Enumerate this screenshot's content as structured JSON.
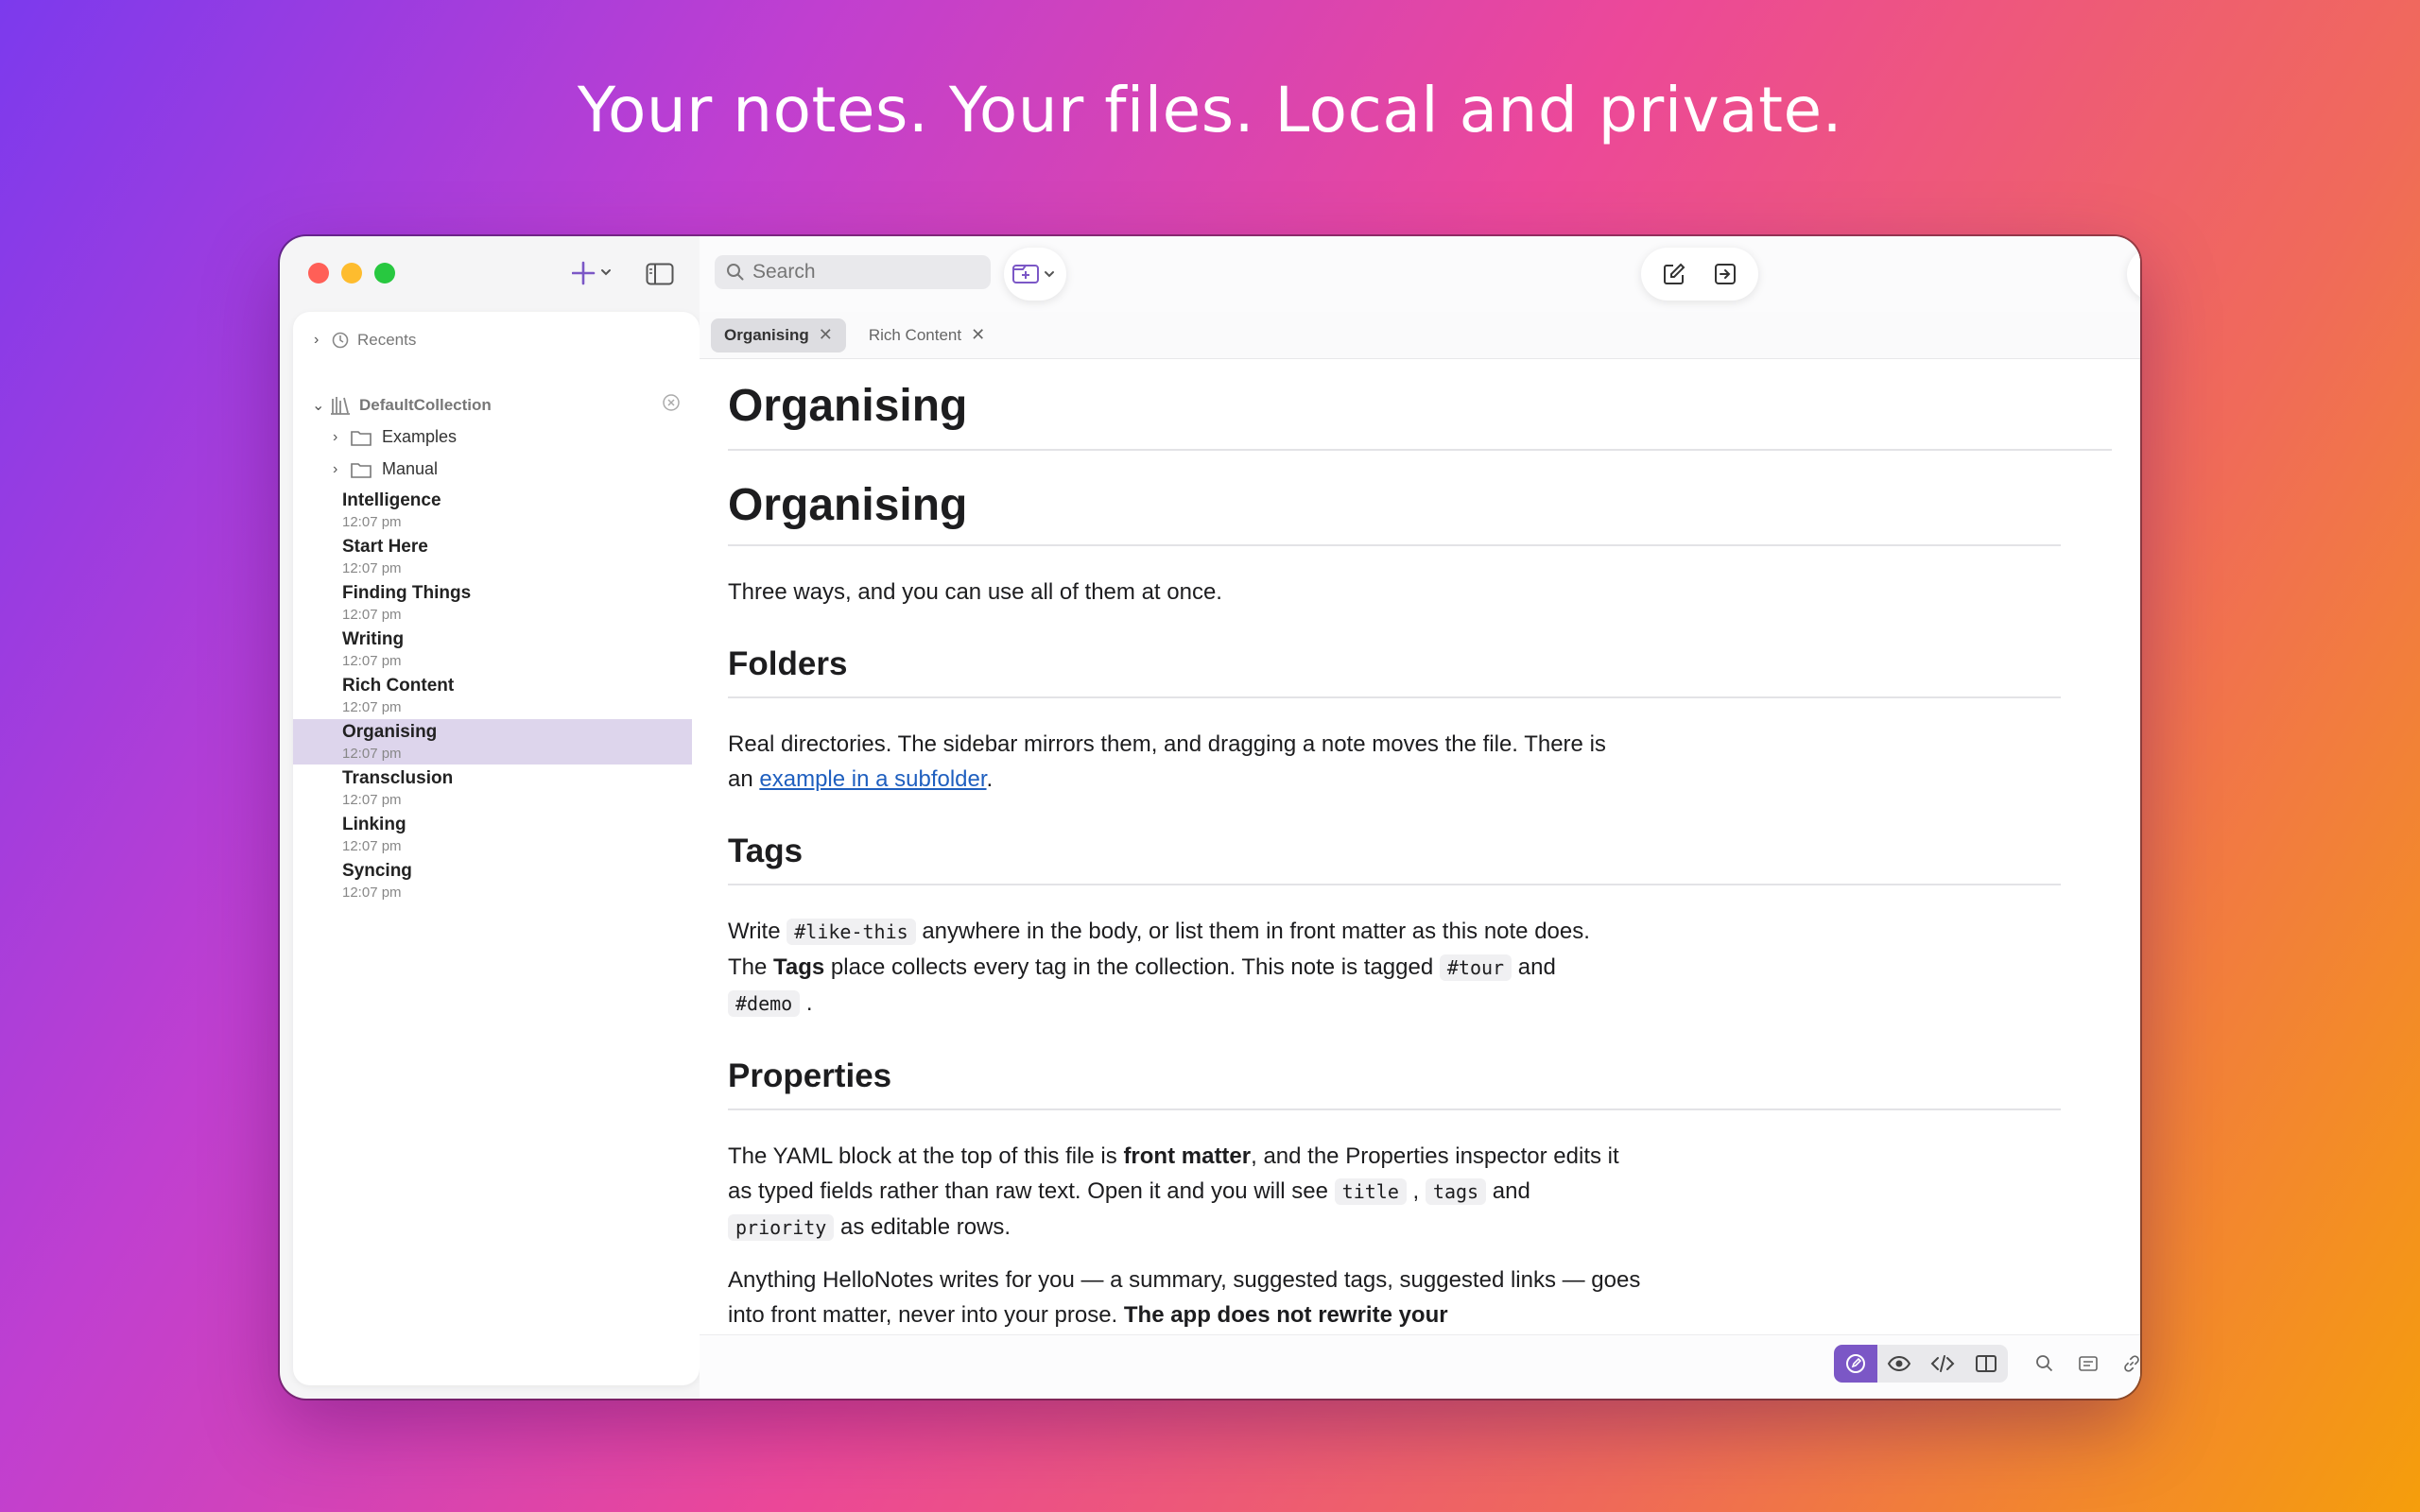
{
  "headline": "Your notes. Your files. Local and private.",
  "toolbar": {
    "search_placeholder": "Search"
  },
  "sidebar": {
    "recents_label": "Recents",
    "collection_label": "DefaultCollection",
    "folders": [
      {
        "label": "Examples"
      },
      {
        "label": "Manual"
      }
    ],
    "notes": [
      {
        "title": "Intelligence",
        "time": "12:07 pm"
      },
      {
        "title": "Start Here",
        "time": "12:07 pm"
      },
      {
        "title": "Finding Things",
        "time": "12:07 pm"
      },
      {
        "title": "Writing",
        "time": "12:07 pm"
      },
      {
        "title": "Rich Content",
        "time": "12:07 pm"
      },
      {
        "title": "Organising",
        "time": "12:07 pm",
        "selected": true
      },
      {
        "title": "Transclusion",
        "time": "12:07 pm"
      },
      {
        "title": "Linking",
        "time": "12:07 pm"
      },
      {
        "title": "Syncing",
        "time": "12:07 pm"
      }
    ]
  },
  "tabs": [
    {
      "label": "Organising",
      "active": true
    },
    {
      "label": "Rich Content",
      "active": false
    }
  ],
  "document": {
    "page_title": "Organising",
    "h1": "Organising",
    "intro": "Three ways, and you can use all of them at once.",
    "folders_heading": "Folders",
    "folders_text_1": "Real directories. The sidebar mirrors them, and dragging a note moves the file. There is an ",
    "folders_link": "example in a subfolder",
    "folders_text_2": ".",
    "tags_heading": "Tags",
    "tags_text_1": "Write ",
    "tags_code_1": "#like-this",
    "tags_text_2": " anywhere in the body, or list them in front matter as this note does. The ",
    "tags_bold": "Tags",
    "tags_text_3": " place collects every tag in the collection. This note is tagged ",
    "tags_code_2": "#tour",
    "tags_text_4": " and ",
    "tags_code_3": "#demo",
    "tags_text_5": " .",
    "props_heading": "Properties",
    "props_text_1": "The YAML block at the top of this file is ",
    "props_bold": "front matter",
    "props_text_2": ", and the Properties inspector edits it as typed fields rather than raw text. Open it and you will see ",
    "props_code_1": "title",
    "props_text_3": " , ",
    "props_code_2": "tags",
    "props_text_4": " and ",
    "props_code_3": "priority",
    "props_text_5": " as editable rows.",
    "ai_text_1": "Anything HelloNotes writes for you — a summary, suggested tags, suggested links — goes into front matter, never into your prose. ",
    "ai_bold": "The app does not rewrite your"
  },
  "colors": {
    "accent": "#7b57c6",
    "selection": "#ddd5ec",
    "link": "#1f5fbf"
  }
}
